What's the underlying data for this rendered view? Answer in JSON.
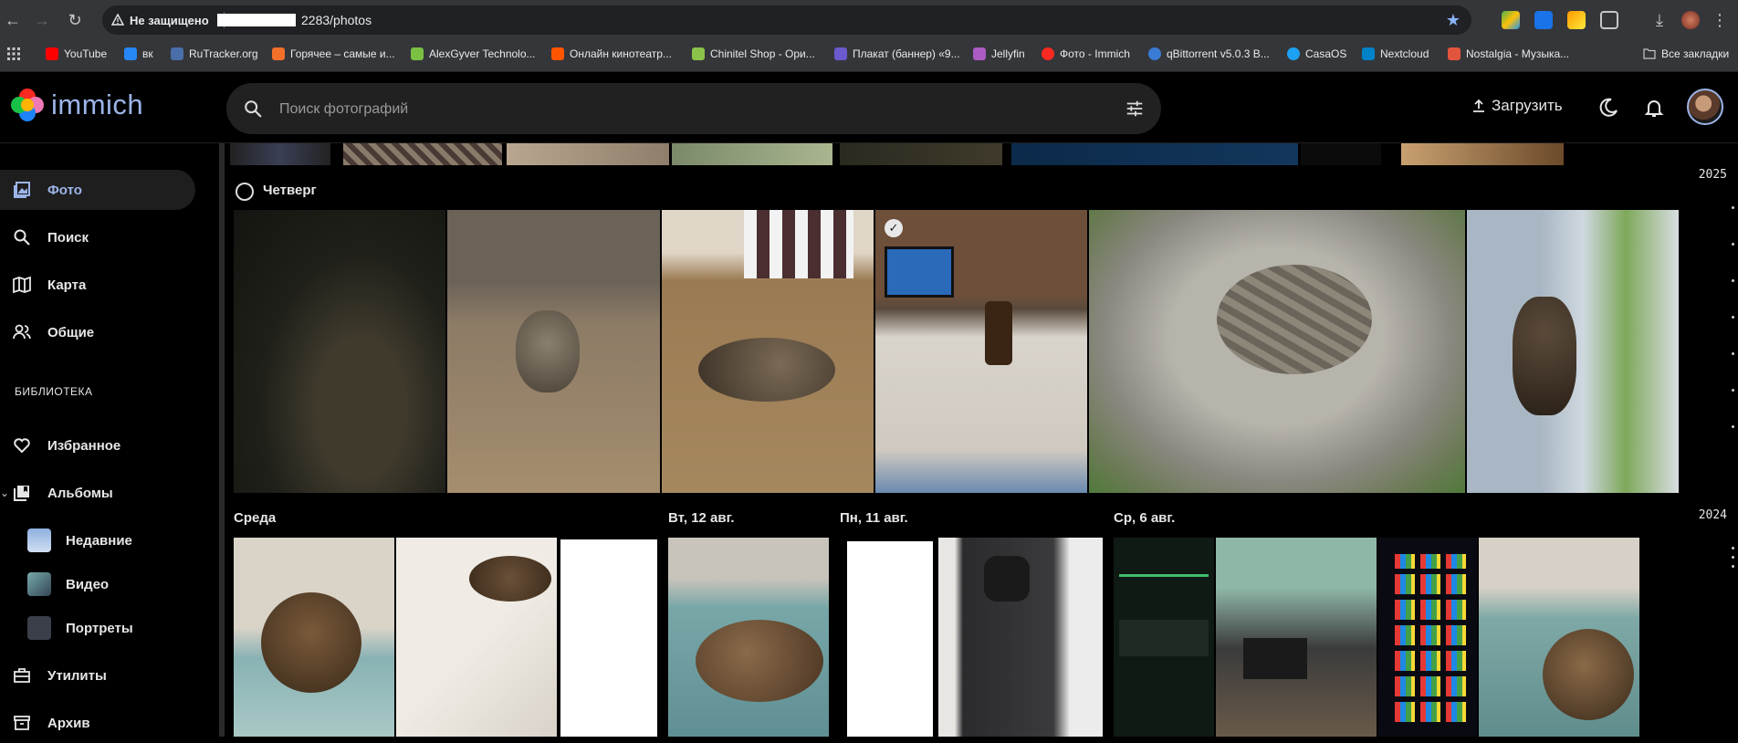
{
  "browser": {
    "security_label": "Не защищено",
    "url_suffix": "2283/photos",
    "bookmarks": [
      {
        "label": "YouTube",
        "color": "#ff0000"
      },
      {
        "label": "вк",
        "color": "#2787f5"
      },
      {
        "label": "RuTracker.org",
        "color": "#4a6ea9"
      },
      {
        "label": "Горячее – самые и...",
        "color": "#f3702b"
      },
      {
        "label": "AlexGyver Technolo...",
        "color": "#7bc043"
      },
      {
        "label": "Онлайн кинотеатр...",
        "color": "#ff5500"
      },
      {
        "label": "Chinitel Shop - Ори...",
        "color": "#8bc34a"
      },
      {
        "label": "Плакат (баннер) «9...",
        "color": "#6a5acd"
      },
      {
        "label": "Jellyfin",
        "color": "#aa5cc3"
      },
      {
        "label": "Фото - Immich",
        "color": "#fa2921"
      },
      {
        "label": "qBittorrent v5.0.3 В...",
        "color": "#3a7bd5"
      },
      {
        "label": "CasaOS",
        "color": "#1da1f2"
      },
      {
        "label": "Nextcloud",
        "color": "#0082c9"
      },
      {
        "label": "Nostalgia - Музыка...",
        "color": "#e2553d"
      }
    ],
    "all_bookmarks": "Все закладки"
  },
  "app": {
    "logo_text": "immich",
    "search_placeholder": "Поиск фотографий",
    "upload_label": "Загрузить",
    "accent": "#9cb4e8"
  },
  "sidebar": {
    "items": [
      {
        "label": "Фото",
        "icon": "photos-icon",
        "active": true
      },
      {
        "label": "Поиск",
        "icon": "search-icon"
      },
      {
        "label": "Карта",
        "icon": "map-icon"
      },
      {
        "label": "Общие",
        "icon": "people-icon"
      }
    ],
    "library_heading": "БИБЛИОТЕКА",
    "library_items": [
      {
        "label": "Избранное",
        "icon": "heart-icon"
      },
      {
        "label": "Альбомы",
        "icon": "albums-icon"
      }
    ],
    "albums": [
      {
        "label": "Недавние"
      },
      {
        "label": "Видео"
      },
      {
        "label": "Портреты"
      }
    ],
    "bottom_items": [
      {
        "label": "Утилиты",
        "icon": "toolbox-icon"
      },
      {
        "label": "Архив",
        "icon": "archive-icon"
      }
    ]
  },
  "timeline": {
    "groups": [
      {
        "title": "Четверг"
      },
      {
        "title": "Среда"
      },
      {
        "title": "Вт, 12 авг."
      },
      {
        "title": "Пн, 11 авг."
      },
      {
        "title": "Ср, 6 авг."
      }
    ]
  },
  "scrubber": {
    "years": [
      "2025",
      "2024"
    ]
  }
}
